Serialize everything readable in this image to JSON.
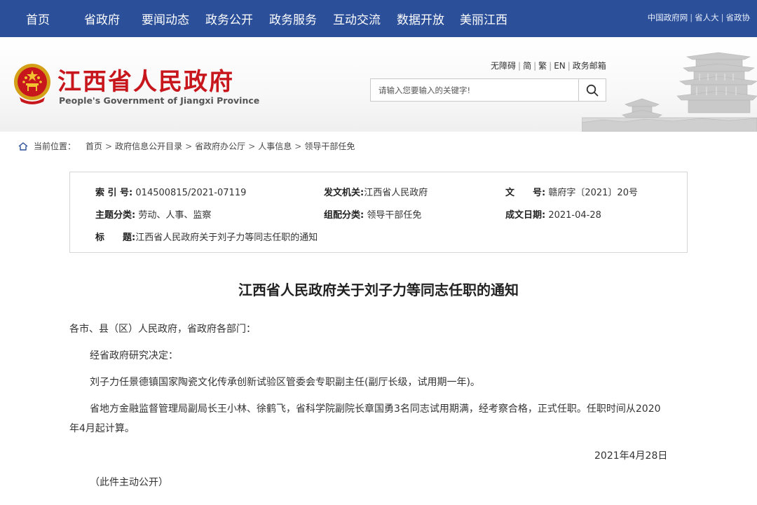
{
  "nav": {
    "items": [
      "首页",
      "省政府",
      "要闻动态",
      "政务公开",
      "政务服务",
      "互动交流",
      "数据开放",
      "美丽江西"
    ],
    "right_links": [
      "中国政府网",
      "省人大",
      "省政协"
    ],
    "bg_color": "#2b4f99"
  },
  "header": {
    "title": "江西省人民政府",
    "subtitle": "People's Government of Jiangxi Province",
    "title_color": "#c8161d",
    "util_links": [
      "无障碍",
      "简",
      "繁",
      "EN",
      "政务邮箱"
    ],
    "search_placeholder": "请输入您要输入的关键字!",
    "search_icon": "search-icon"
  },
  "breadcrumb": {
    "label": "当前位置：",
    "items": [
      "首页",
      "政府信息公开目录",
      "省政府办公厅",
      "人事信息",
      "领导干部任免"
    ]
  },
  "meta": {
    "index_label": "索 引 号:",
    "index_value": "014500815/2021-07119",
    "issuer_label": "发文机关:",
    "issuer_value": "江西省人民政府",
    "docno_label": "文　　号:",
    "docno_value": "赣府字〔2021〕20号",
    "topic_label": "主题分类:",
    "topic_value": "劳动、人事、监察",
    "category_label": "组配分类:",
    "category_value": "领导干部任免",
    "date_label": "成文日期:",
    "date_value": "2021-04-28",
    "title_label": "标　　题:",
    "title_value": "江西省人民政府关于刘子力等同志任职的通知"
  },
  "article": {
    "title": "江西省人民政府关于刘子力等同志任职的通知",
    "salutation": "各市、县（区）人民政府，省政府各部门：",
    "p1": "经省政府研究决定：",
    "p2": "刘子力任景德镇国家陶瓷文化传承创新试验区管委会专职副主任(副厅长级，试用期一年)。",
    "p3_line1": "省地方金融监督管理局副局长王小林、徐鹤飞，省科学院副院长章国勇3名同志试用期满，经考察合格，正式任职。任职时间从2020",
    "p3_line2": "年4月起计算。",
    "date": "2021年4月28日",
    "note": "（此件主动公开）"
  }
}
